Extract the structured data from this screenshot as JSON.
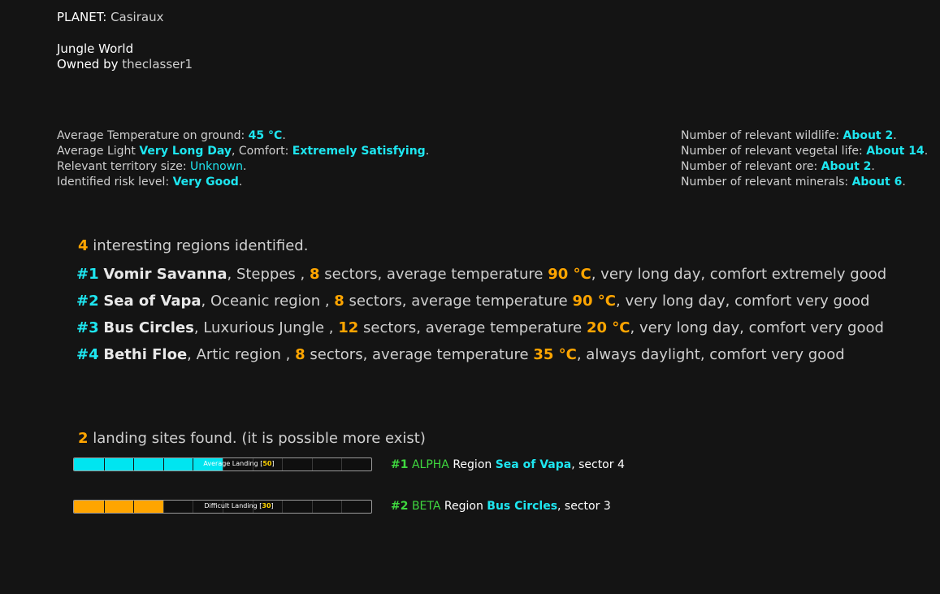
{
  "planet": {
    "label": "PLANET:",
    "name": "Casiraux",
    "type": "Jungle World",
    "owned_label": "Owned by",
    "owner": "theclasser1"
  },
  "left_info": {
    "temp_label": "Average Temperature on ground:",
    "temp_value": "45 °C",
    "light_label": "Average Light",
    "light_value": "Very Long Day",
    "comfort_label": ", Comfort:",
    "comfort_value": "Extremely Satisfying",
    "territory_label": "Relevant territory size:",
    "territory_value": "Unknown",
    "risk_label": "Identified risk level:",
    "risk_value": "Very Good"
  },
  "right_info": {
    "wildlife_label": "Number of relevant wildlife:",
    "wildlife_value": "About 2",
    "vegetal_label": "Number of relevant vegetal life:",
    "vegetal_value": "About 14",
    "ore_label": "Number of relevant ore:",
    "ore_value": "About 2",
    "minerals_label": "Number of relevant minerals:",
    "minerals_value": "About 6"
  },
  "regions": {
    "count": "4",
    "header_text": "interesting regions identified.",
    "sectors_text": "sectors, average temperature",
    "items": [
      {
        "num": "#1",
        "name": "Vomir Savanna",
        "type": ", Steppes ,",
        "sectors": "8",
        "temp": "90 °C",
        "desc": ", very long day, comfort extremely good"
      },
      {
        "num": "#2",
        "name": "Sea of Vapa",
        "type": ", Oceanic region ,",
        "sectors": "8",
        "temp": "90 °C",
        "desc": ", very long day, comfort very good"
      },
      {
        "num": "#3",
        "name": "Bus Circles",
        "type": ", Luxurious Jungle ,",
        "sectors": "12",
        "temp": "20 °C",
        "desc": ", very long day, comfort very good"
      },
      {
        "num": "#4",
        "name": "Bethi Floe",
        "type": ", Artic region ,",
        "sectors": "8",
        "temp": "35 °C",
        "desc": ", always daylight, comfort very good"
      }
    ]
  },
  "landing": {
    "count": "2",
    "header_text": "landing sites found. (it is possible more exist)",
    "region_label": "Region",
    "sector_label": ", sector",
    "sites": [
      {
        "bar_label": "Average Landing [",
        "level": "50",
        "bar_close": "]",
        "fill_percent": 50,
        "color": "#00e5f0",
        "num": "#1",
        "code": "ALPHA",
        "region": "Sea of Vapa",
        "sector": "4"
      },
      {
        "bar_label": "Difficult Landing [",
        "level": "30",
        "bar_close": "]",
        "fill_percent": 30,
        "color": "#ffa500",
        "num": "#2",
        "code": "BETA",
        "region": "Bus Circles",
        "sector": "3"
      }
    ]
  },
  "colors": {
    "background": "#141414",
    "accent_cyan": "#1ee6f0",
    "accent_orange": "#ffa500",
    "accent_green": "#3fd83f",
    "level_yellow": "#ffd400"
  }
}
